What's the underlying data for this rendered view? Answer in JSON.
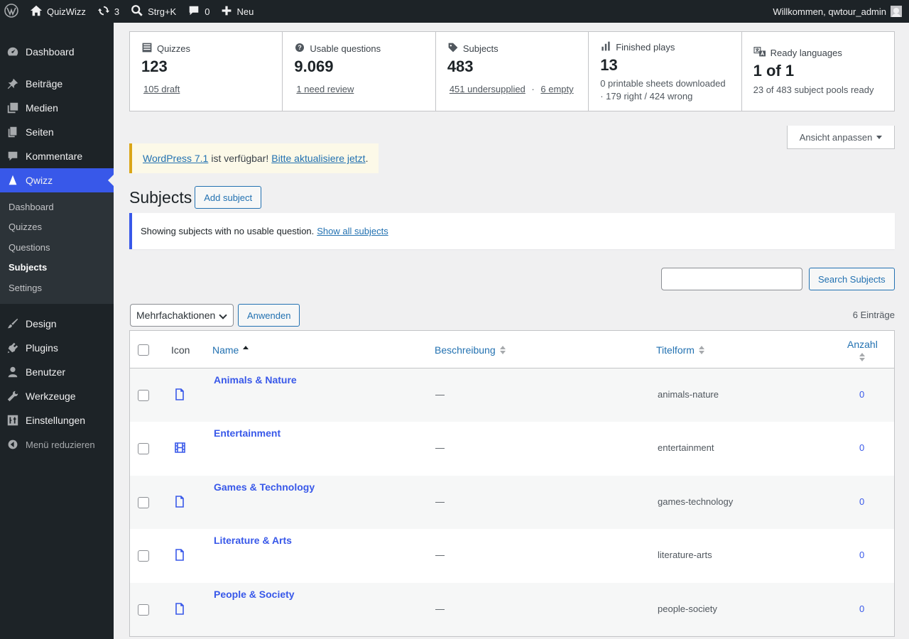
{
  "adminbar": {
    "site_name": "QuizWizz",
    "updates_count": "3",
    "search_shortcut": "Strg+K",
    "comments_count": "0",
    "new_label": "Neu",
    "welcome": "Willkommen, qwtour_admin"
  },
  "sidebar": {
    "items_top": [
      "Dashboard",
      "Beiträge",
      "Medien",
      "Seiten",
      "Kommentare"
    ],
    "active": "Qwizz",
    "submenu": [
      "Dashboard",
      "Quizzes",
      "Questions",
      "Subjects",
      "Settings"
    ],
    "items_bottom": [
      "Design",
      "Plugins",
      "Benutzer",
      "Werkzeuge",
      "Einstellungen"
    ],
    "collapse": "Menü reduzieren"
  },
  "stats": {
    "quizzes": {
      "label": "Quizzes",
      "value": "123",
      "sub": "105 draft"
    },
    "usable": {
      "label": "Usable questions",
      "value": "9.069",
      "sub": "1 need review"
    },
    "subjects": {
      "label": "Subjects",
      "value": "483",
      "sub1": "451 undersupplied",
      "sep": "·",
      "sub2": "6 empty"
    },
    "plays": {
      "label": "Finished plays",
      "value": "13",
      "line1": "0 printable sheets downloaded",
      "line2": "· 179 right / 424 wrong"
    },
    "languages": {
      "label": "Ready languages",
      "value": "1 of 1",
      "sub": "23 of 483 subject pools ready"
    }
  },
  "screen_options": "Ansicht anpassen",
  "update_nag": {
    "link1": "WordPress 7.1",
    "text": "ist verfügbar!",
    "link2": "Bitte aktualisiere jetzt",
    "end": "."
  },
  "page": {
    "title": "Subjects",
    "add_button": "Add subject"
  },
  "notice": {
    "text": "Showing subjects with no usable question.",
    "link": "Show all subjects"
  },
  "search": {
    "value": "",
    "button": "Search Subjects"
  },
  "bulk": {
    "selected": "Mehrfachaktionen",
    "apply": "Anwenden",
    "count": "6 Einträge"
  },
  "table": {
    "headers": {
      "icon": "Icon",
      "name": "Name",
      "description": "Beschreibung",
      "slug": "Titelform",
      "count": "Anzahl"
    },
    "rows": [
      {
        "name": "Animals & Nature",
        "description": "—",
        "slug": "animals-nature",
        "count": "0",
        "icon": "file-icon"
      },
      {
        "name": "Entertainment",
        "description": "—",
        "slug": "entertainment",
        "count": "0",
        "icon": "film-icon"
      },
      {
        "name": "Games & Technology",
        "description": "—",
        "slug": "games-technology",
        "count": "0",
        "icon": "file-icon"
      },
      {
        "name": "Literature & Arts",
        "description": "—",
        "slug": "literature-arts",
        "count": "0",
        "icon": "file-icon"
      },
      {
        "name": "People & Society",
        "description": "—",
        "slug": "people-society",
        "count": "0",
        "icon": "file-icon"
      }
    ]
  },
  "colors": {
    "admin_dark": "#1d2327",
    "accent": "#3858e9",
    "link": "#2271b1",
    "nag_border": "#dba617"
  }
}
